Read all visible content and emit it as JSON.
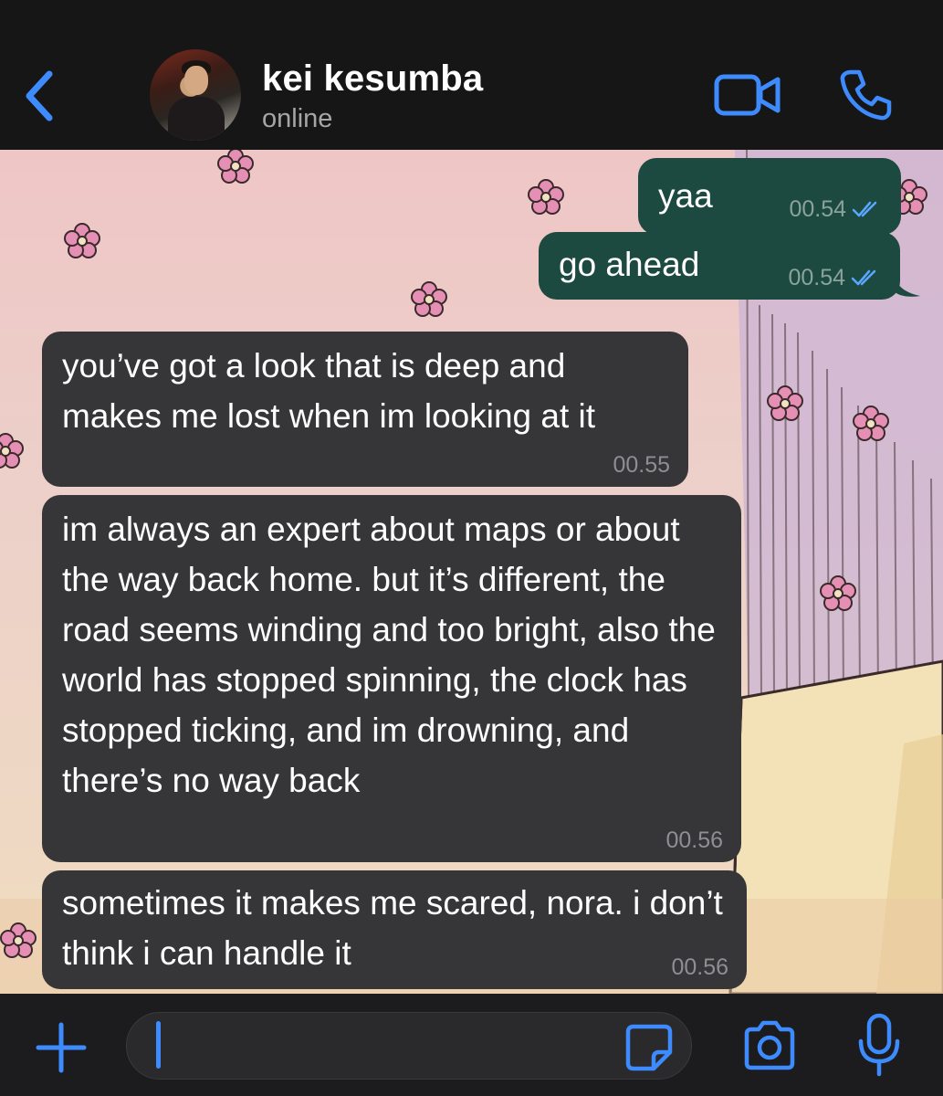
{
  "header": {
    "contact_name": "kei kesumba",
    "status": "online",
    "icons": {
      "back": "chevron-left-icon",
      "video": "video-camera-icon",
      "call": "phone-icon"
    }
  },
  "messages": [
    {
      "direction": "outgoing",
      "text": "yaa",
      "time": "00.54",
      "receipt": "read-double-check-icon"
    },
    {
      "direction": "outgoing",
      "text": "go ahead",
      "time": "00.54",
      "receipt": "read-double-check-icon"
    },
    {
      "direction": "incoming",
      "text": "you’ve got a look that is deep and makes me lost when im looking at it",
      "time": "00.55"
    },
    {
      "direction": "incoming",
      "text": "im always an expert about maps or about the way back home. but it’s different, the road seems winding and too bright, also the world has stopped spinning, the clock has stopped ticking, and im drowning, and there’s no way back",
      "time": "00.56"
    },
    {
      "direction": "incoming",
      "text": "sometimes it makes me scared, nora. i don’t think i can handle it",
      "time": "00.56"
    }
  ],
  "composer": {
    "value": "",
    "icons": {
      "attach": "plus-icon",
      "sticker": "sticker-icon",
      "camera": "camera-icon",
      "mic": "microphone-icon"
    }
  },
  "colors": {
    "accent": "#3d8bfd",
    "outgoing_bubble": "#1c4a40",
    "incoming_bubble": "#363638",
    "header_bg": "#161616",
    "wallpaper": "#efc6c6"
  }
}
